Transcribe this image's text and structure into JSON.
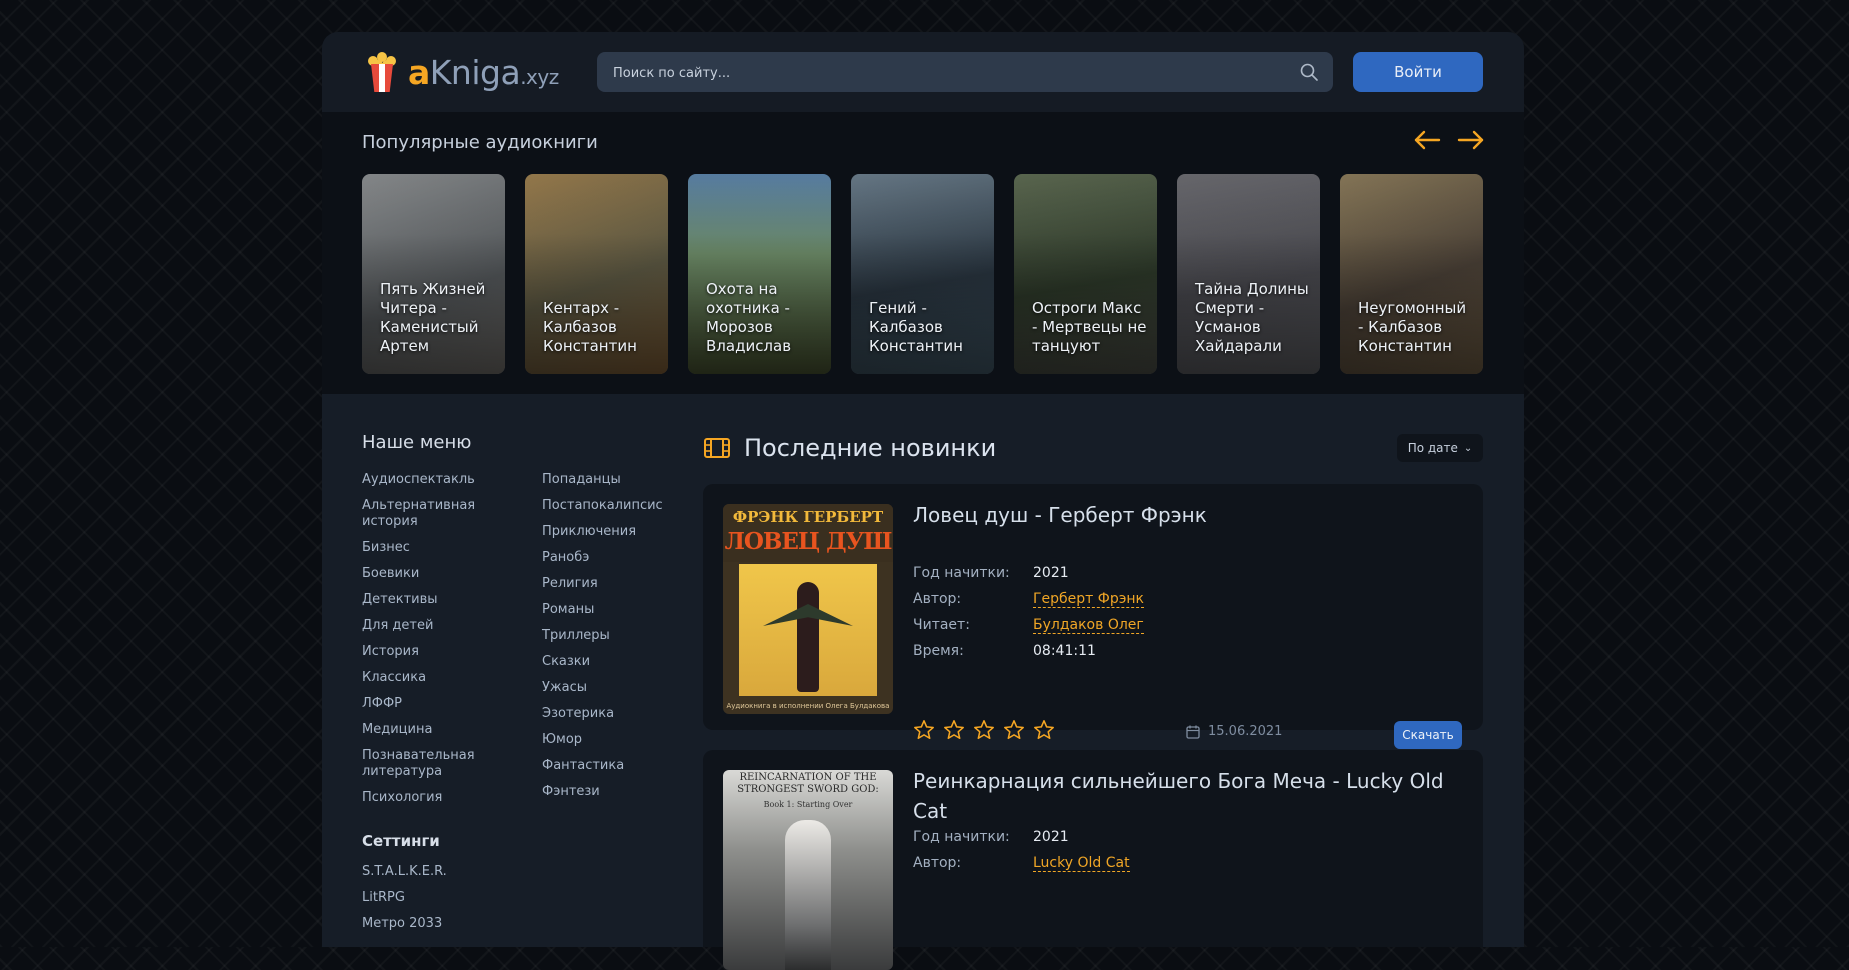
{
  "header": {
    "logo": {
      "a": "a",
      "main": "Kniga",
      "domain": ".xyz"
    },
    "search": {
      "placeholder": "Поиск по сайту..."
    },
    "login_label": "Войти"
  },
  "popular": {
    "title": "Популярные аудиокниги",
    "items": [
      {
        "title": "Пять Жизней Читера - Каменистый Артем",
        "color": "#6b6f73"
      },
      {
        "title": "Кентарх - Калбазов Константин",
        "color": "#7a6a46"
      },
      {
        "title": "Охота на охотника - Морозов Владислав",
        "color": "#4f5a3e"
      },
      {
        "title": "Гений - Калбазов Константин",
        "color": "#3b4a57"
      },
      {
        "title": "Остроги Макс - Мертвецы не танцуют",
        "color": "#3f4a3a"
      },
      {
        "title": "Тайна Долины Смерти - Усманов Хайдарали",
        "color": "#5c5d62"
      },
      {
        "title": "Неугомонный - Калбазов Константин",
        "color": "#6b5a42"
      }
    ]
  },
  "menu": {
    "title": "Наше меню",
    "col1": [
      "Аудиоспектакль",
      "Альтернативная история",
      "Бизнес",
      "Боевики",
      "Детективы",
      "Для детей",
      "История",
      "Классика",
      "ЛФФР",
      "Медицина",
      "Познавательная литература",
      "Психология"
    ],
    "col2": [
      "Попаданцы",
      "Постапокалипсис",
      "Приключения",
      "Ранобэ",
      "Религия",
      "Романы",
      "Триллеры",
      "Сказки",
      "Ужасы",
      "Эзотерика",
      "Юмор",
      "Фантастика",
      "Фэнтези"
    ],
    "settings_title": "Сеттинги",
    "settings": [
      "S.T.A.L.K.E.R.",
      "LitRPG",
      "Метро 2033"
    ]
  },
  "latest": {
    "title": "Последние новинки",
    "sort_label": "По дате",
    "books": [
      {
        "title": "Ловец душ - Герберт Фрэнк",
        "cover_top": "ФРЭНК ГЕРБЕРТ",
        "cover_title": "ЛОВЕЦ ДУШ",
        "cover_bottom": "Аудиокнига в исполнении Олега Булдакова",
        "year_label": "Год начитки:",
        "year": "2021",
        "author_label": "Автор:",
        "author": "Герберт Фрэнк",
        "reader_label": "Читает:",
        "reader": "Булдаков Олег",
        "time_label": "Время:",
        "time": "08:41:11",
        "date": "15.06.2021",
        "download_label": "Скачать",
        "stars": 5
      },
      {
        "title": "Реинкарнация сильнейшего Бога Меча - Lucky Old Cat",
        "cover_top": "REINCARNATION OF THE STRONGEST SWORD GOD:",
        "cover_sub": "Book 1: Starting Over",
        "year_label": "Год начитки:",
        "year": "2021",
        "author_label": "Автор:",
        "author": "Lucky Old Cat"
      }
    ]
  },
  "colors": {
    "accent": "#f5a623",
    "primary": "#2f68c0",
    "panel": "#0f141b"
  }
}
